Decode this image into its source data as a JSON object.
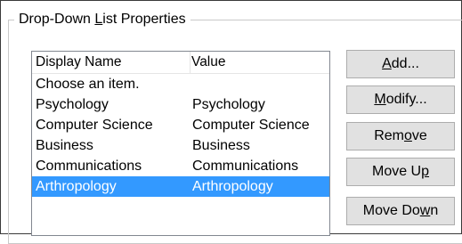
{
  "group": {
    "title_pre": "Drop-Down ",
    "title_key": "L",
    "title_post": "ist Properties"
  },
  "list": {
    "columns": [
      "Display Name",
      "Value"
    ],
    "rows": [
      {
        "display": "Choose an item.",
        "value": ""
      },
      {
        "display": "Psychology",
        "value": "Psychology"
      },
      {
        "display": "Computer Science",
        "value": "Computer Science"
      },
      {
        "display": "Business",
        "value": "Business"
      },
      {
        "display": "Communications",
        "value": "Communications"
      },
      {
        "display": "Arthropology",
        "value": "Arthropology"
      }
    ],
    "selected_index": 5
  },
  "buttons": {
    "add": {
      "key": "A",
      "rest": "dd..."
    },
    "modify": {
      "key": "M",
      "rest": "odify..."
    },
    "remove": {
      "pre": "Rem",
      "key": "o",
      "post": "ve"
    },
    "move_up": {
      "pre": "Move U",
      "key": "p",
      "post": ""
    },
    "move_down": {
      "pre": "Move Do",
      "key": "w",
      "post": "n"
    }
  },
  "colors": {
    "selection": "#3399ff",
    "button_face": "#e1e1e1"
  }
}
